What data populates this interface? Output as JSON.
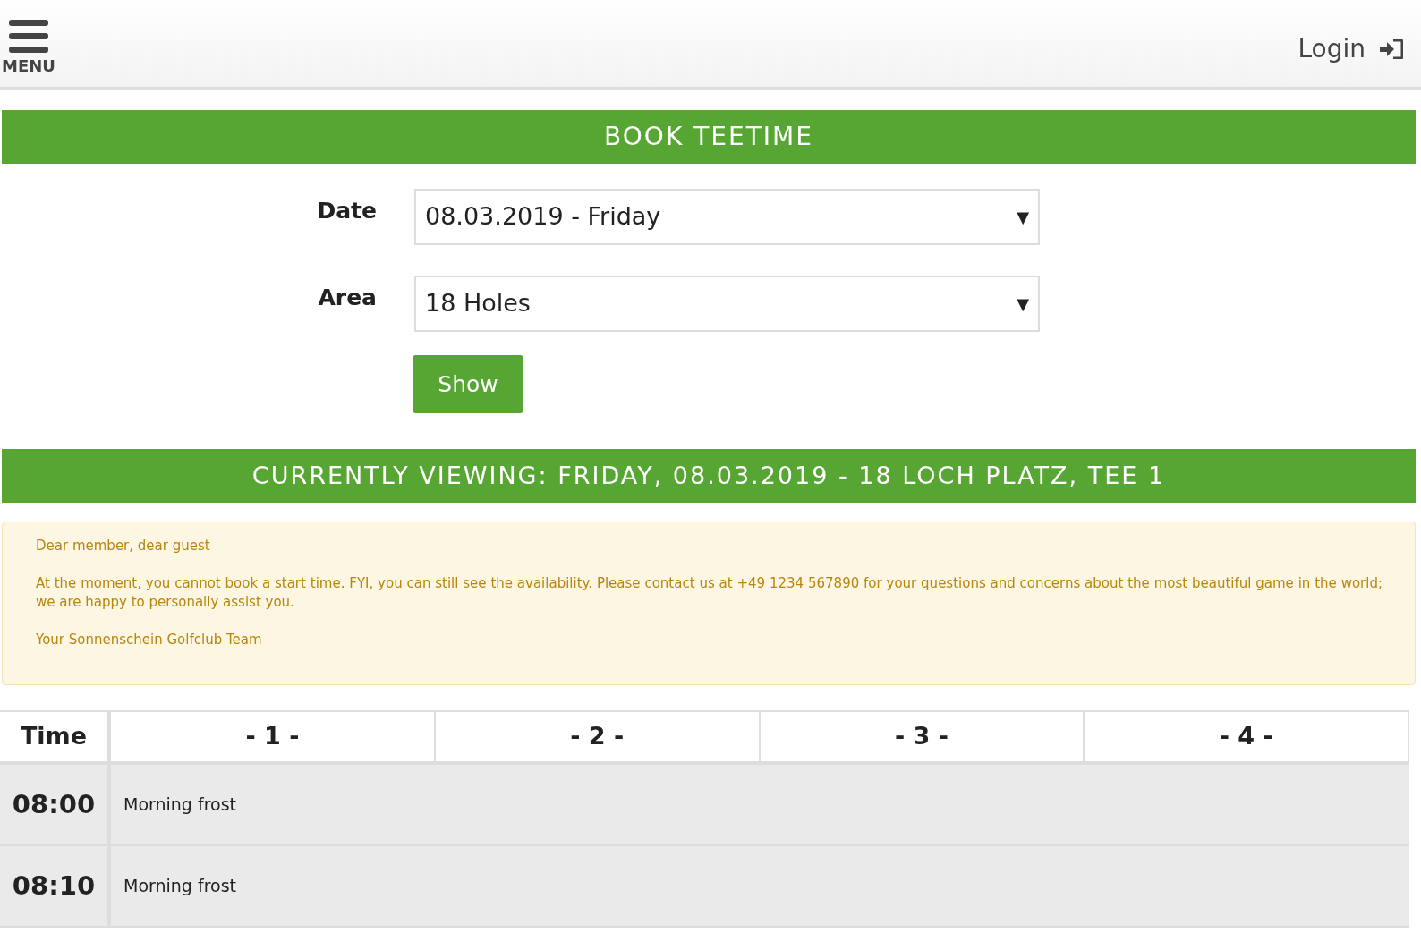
{
  "header": {
    "menu_label": "MENU",
    "login_label": "Login"
  },
  "booking": {
    "title": "BOOK TEETIME",
    "fields": [
      {
        "label": "Date",
        "value": "08.03.2019 - Friday",
        "arrow": "▼"
      },
      {
        "label": "Area",
        "value": "18 Holes",
        "arrow": "▼"
      }
    ],
    "show_button": "Show"
  },
  "viewing_title": "CURRENTLY VIEWING: FRIDAY, 08.03.2019 - 18 LOCH PLATZ, TEE 1",
  "notice": [
    "Dear member, dear guest",
    "At the moment, you cannot book a start time. FYI, you can still see the availability. Please contact us at +49 1234 567890 for your questions and concerns about the most beautiful game in the world; we are happy to personally assist you.",
    "Your Sonnenschein Golfclub Team"
  ],
  "table": {
    "columns": [
      "Time",
      "- 1 -",
      "- 2 -",
      "- 3 -",
      "- 4 -"
    ],
    "rows": [
      {
        "time": "08:00",
        "note": "Morning frost"
      },
      {
        "time": "08:10",
        "note": "Morning frost"
      }
    ]
  }
}
